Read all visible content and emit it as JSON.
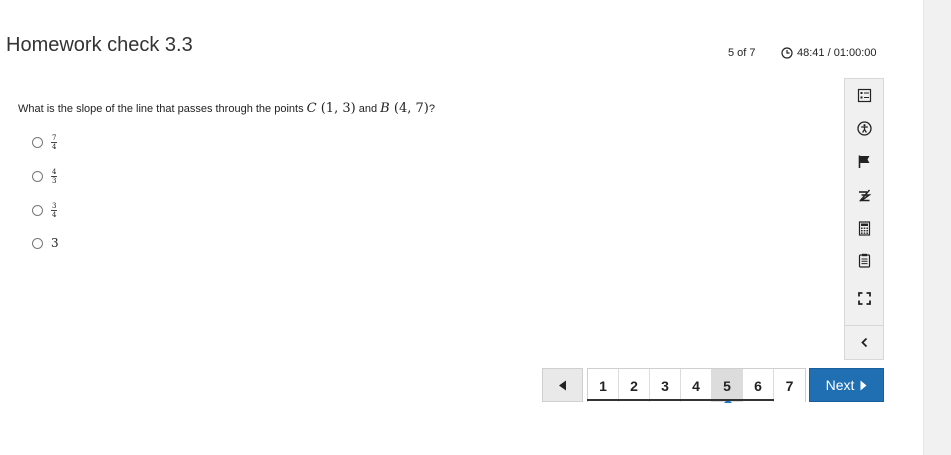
{
  "header": {
    "title": "Homework check 3.3",
    "progress": "5 of 7",
    "timer": "48:41 / 01:00:00"
  },
  "question": {
    "prefix": "What is the slope of the line that passes through the points",
    "point_c_label": "C",
    "point_c_coords": "(1, 3)",
    "conjunction": "and",
    "point_b_label": "B",
    "point_b_coords": "(4, 7)",
    "suffix": "?"
  },
  "choices": [
    {
      "numerator": "7",
      "denominator": "4"
    },
    {
      "numerator": "4",
      "denominator": "3"
    },
    {
      "numerator": "3",
      "denominator": "4"
    },
    {
      "value": "3"
    }
  ],
  "toolbar": {
    "icons": [
      "list-icon",
      "accessibility-icon",
      "flag-icon",
      "eliminate-choice-icon",
      "calculator-icon",
      "notepad-icon",
      "fullscreen-icon",
      "collapse-chevron-icon"
    ]
  },
  "pagination": {
    "pages": [
      "1",
      "2",
      "3",
      "4",
      "5",
      "6",
      "7"
    ],
    "current": "5",
    "next_label": "Next"
  },
  "colors": {
    "accent": "#1f6fb2",
    "current_page_bg": "#dcdcdc"
  }
}
